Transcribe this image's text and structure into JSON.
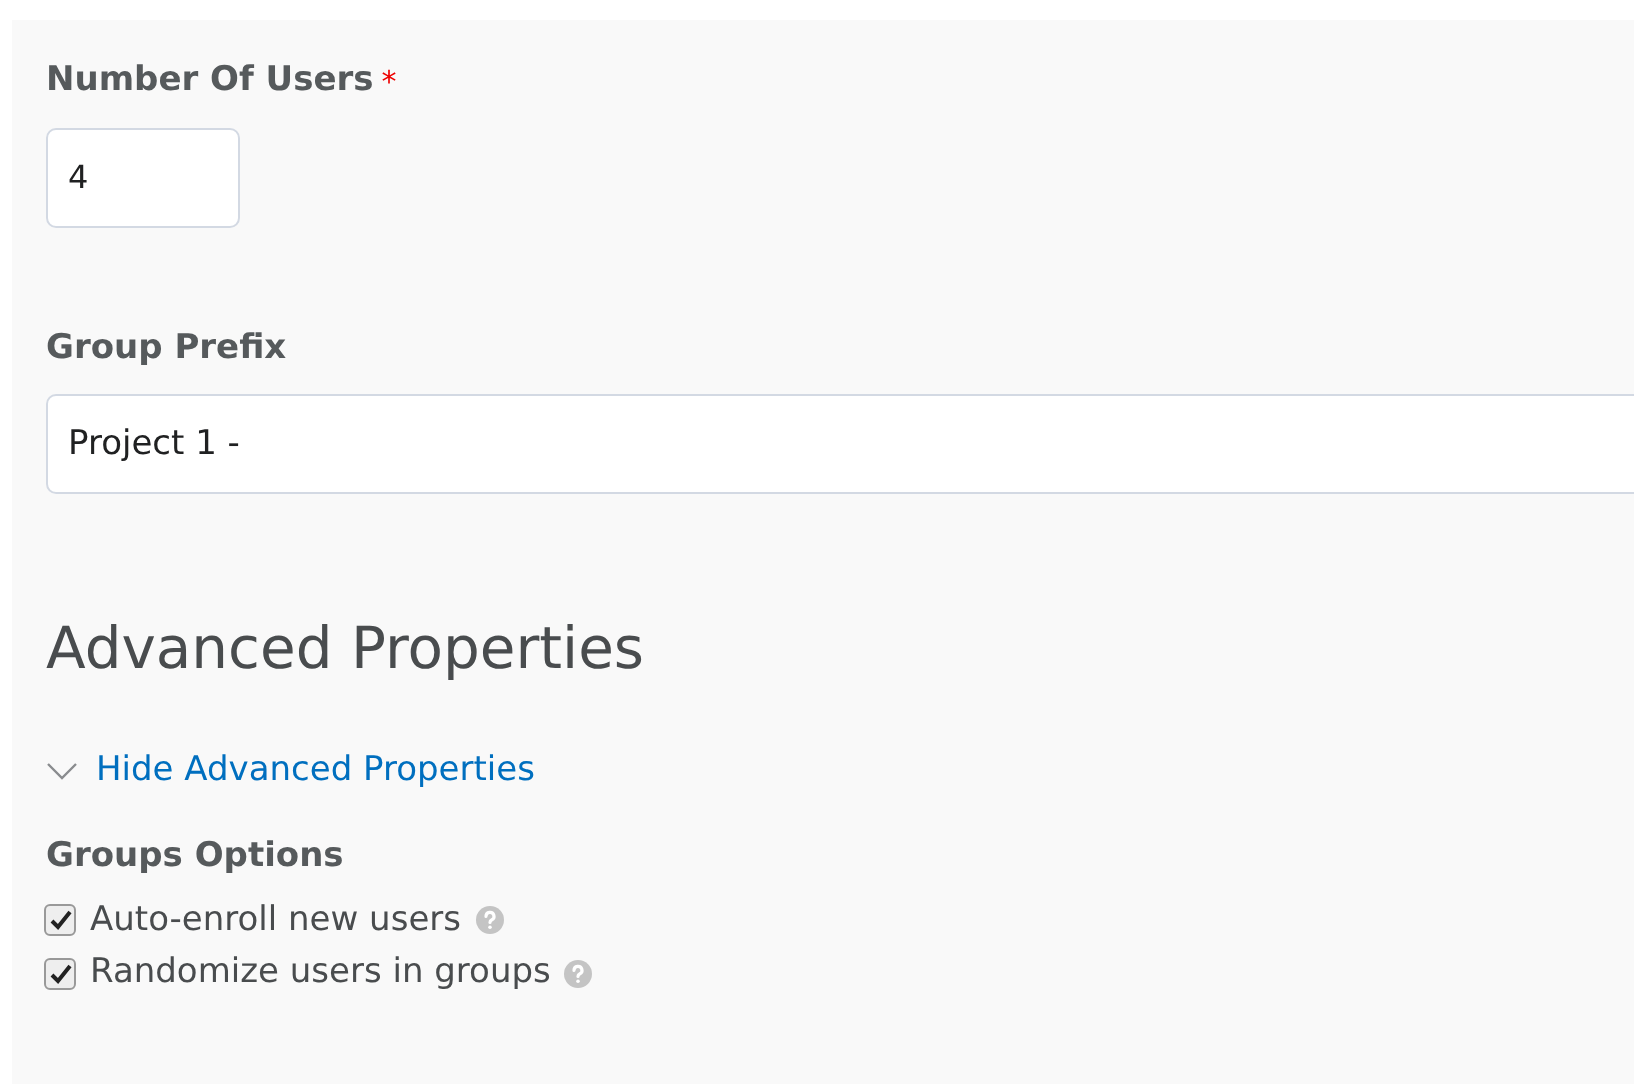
{
  "number_of_users": {
    "label": "Number Of Users",
    "required_mark": "*",
    "value": "4"
  },
  "group_prefix": {
    "label": "Group Prefix",
    "value": "Project 1 -"
  },
  "advanced": {
    "heading": "Advanced Properties",
    "toggle": {
      "label": "Hide Advanced Properties",
      "expanded": true
    },
    "options_label": "Groups Options",
    "options": [
      {
        "label": "Auto-enroll new users",
        "checked": true
      },
      {
        "label": "Randomize users in groups",
        "checked": true
      }
    ]
  }
}
